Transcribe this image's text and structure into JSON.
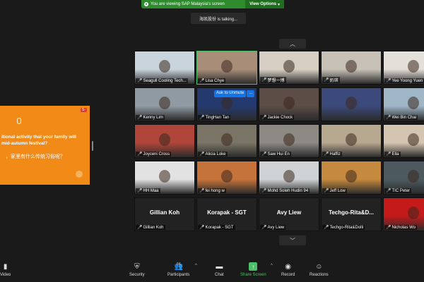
{
  "banner": {
    "message": "You are viewing SAP Malaysia's screen",
    "view_options": "View Options"
  },
  "talking": "海凯股份 is talking...",
  "shared_screen": {
    "logo": "S-",
    "question_en": "itional activity that your family will\n mid-autumn festival?",
    "question_zh": "，家里有什么传统习俗呢？"
  },
  "ask_unmute": {
    "label": "Ask to Unmute",
    "more": "..."
  },
  "participants_tiles": [
    {
      "name": "Seagull Cooling Tech...",
      "bg": "#c9d4dc"
    },
    {
      "name": "Lisa Chye",
      "bg": "#a88e78"
    },
    {
      "name": "梦想一博",
      "bg": "#d7cfc4"
    },
    {
      "name": "奶琪",
      "bg": "#c7c1b8"
    },
    {
      "name": "Yee Yoong Yuen",
      "bg": "#e3dfd9"
    },
    {
      "name": "Kenny Lim",
      "bg": "#8f9aa3"
    },
    {
      "name": "TingHan Tan",
      "bg": "#243a6e"
    },
    {
      "name": "Jackie Chock",
      "bg": "#5c4d46"
    },
    {
      "name": "",
      "bg": "#3b4a7a"
    },
    {
      "name": "Wei Bin Chai",
      "bg": "#9fb6c6"
    },
    {
      "name": "Joyceni Cross",
      "bg": "#b0463a"
    },
    {
      "name": "Alicia Loke",
      "bg": "#7a7566"
    },
    {
      "name": "Saw Hui En",
      "bg": "#8d8a84"
    },
    {
      "name": "Haffiz",
      "bg": "#b7a890"
    },
    {
      "name": "Ella",
      "bg": "#d4c5b0"
    },
    {
      "name": "HH Maa",
      "bg": "#e2e2e2"
    },
    {
      "name": "fei hong w",
      "bg": "#c5733a"
    },
    {
      "name": "Mohd Soleh Hudin 94",
      "bg": "#cfd3d6"
    },
    {
      "name": "Jeff Low",
      "bg": "#c58a3e"
    },
    {
      "name": "TIC Peter",
      "bg": "#4c5a60"
    },
    {
      "name": "Gillian Koh",
      "big": "Gillian Koh",
      "blank": true
    },
    {
      "name": "Korapak - SGT",
      "big": "Korapak - SGT",
      "blank": true
    },
    {
      "name": "Avy Liew",
      "big": "Avy Liew",
      "blank": true
    },
    {
      "name": "Techgo-Rita&Dolli",
      "big": "Techgo-Rita&D...",
      "blank": true
    },
    {
      "name": "Nicholas Wo",
      "bg": "#c41a1a"
    }
  ],
  "toolbar": {
    "video": "Video",
    "security": "Security",
    "participants": "Participants",
    "participants_count": "84",
    "chat": "Chat",
    "share_screen": "Share Screen",
    "record": "Record",
    "reactions": "Reactions"
  }
}
